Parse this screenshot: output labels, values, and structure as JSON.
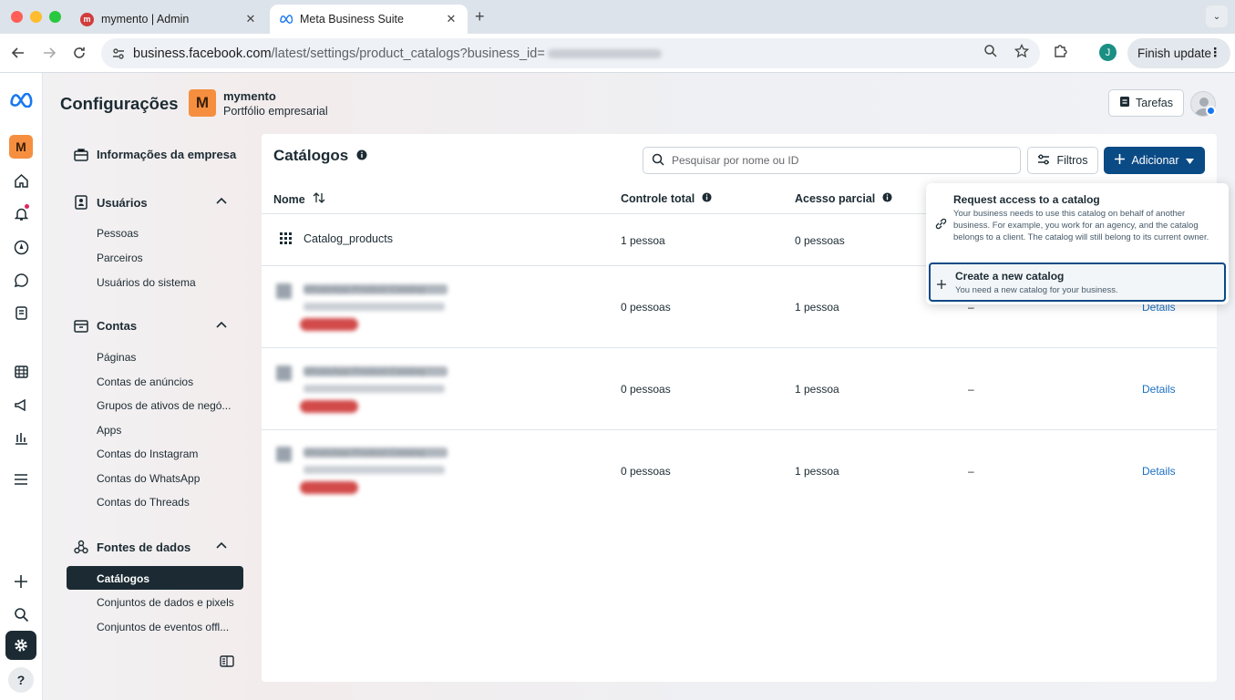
{
  "browser": {
    "tabs": [
      {
        "title": "mymento | Admin",
        "active": false,
        "favicon": "mymento-favicon"
      },
      {
        "title": "Meta Business Suite",
        "active": true,
        "favicon": "meta-favicon"
      }
    ],
    "url_host": "business.facebook.com",
    "url_path": "/latest/settings/product_catalogs?business_id=",
    "profile_initial": "J",
    "finish_update_label": "Finish update"
  },
  "header": {
    "title": "Configurações",
    "business_initial": "M",
    "business_name": "mymento",
    "business_subtitle": "Portfólio empresarial",
    "tasks_label": "Tarefas"
  },
  "rail": {
    "business_initial": "M"
  },
  "settings_nav": {
    "company_info": "Informações da empresa",
    "users": {
      "label": "Usuários",
      "items": [
        "Pessoas",
        "Parceiros",
        "Usuários do sistema"
      ]
    },
    "accounts": {
      "label": "Contas",
      "items": [
        "Páginas",
        "Contas de anúncios",
        "Grupos de ativos de negó...",
        "Apps",
        "Contas do Instagram",
        "Contas do WhatsApp",
        "Contas do Threads"
      ]
    },
    "data_sources": {
      "label": "Fontes de dados",
      "items": [
        "Catálogos",
        "Conjuntos de dados e pixels",
        "Conjuntos de eventos offl..."
      ],
      "active": "Catálogos"
    }
  },
  "catalogs": {
    "title": "Catálogos",
    "search_placeholder": "Pesquisar por nome ou ID",
    "filters_label": "Filtros",
    "add_label": "Adicionar",
    "columns": {
      "name": "Nome",
      "full_control": "Controle total",
      "partial_access": "Acesso parcial"
    },
    "rows": [
      {
        "name": "Catalog_products",
        "full_control": "1 pessoa",
        "partial_access": "0 pessoas",
        "extra": "",
        "action": ""
      },
      {
        "name": "WhatsApp Product Catalog",
        "full_control": "0 pessoas",
        "partial_access": "1 pessoa",
        "extra": "–",
        "action": "Details"
      },
      {
        "name": "WhatsApp Product Catalog",
        "full_control": "0 pessoas",
        "partial_access": "1 pessoa",
        "extra": "–",
        "action": "Details"
      },
      {
        "name": "WhatsApp Product Catalog",
        "full_control": "0 pessoas",
        "partial_access": "1 pessoa",
        "extra": "–",
        "action": "Details"
      }
    ]
  },
  "add_menu": {
    "request_title": "Request access to a catalog",
    "request_desc": "Your business needs to use this catalog on behalf of another business. For example, you work for an agency, and the catalog belongs to a client. The catalog will still belong to its current owner.",
    "create_title": "Create a new catalog",
    "create_desc": "You need a new catalog for your business."
  },
  "colors": {
    "accent": "#0a4a85",
    "link": "#1a6fc2",
    "dark": "#1c2b33",
    "brand_orange": "#f58f3f"
  }
}
